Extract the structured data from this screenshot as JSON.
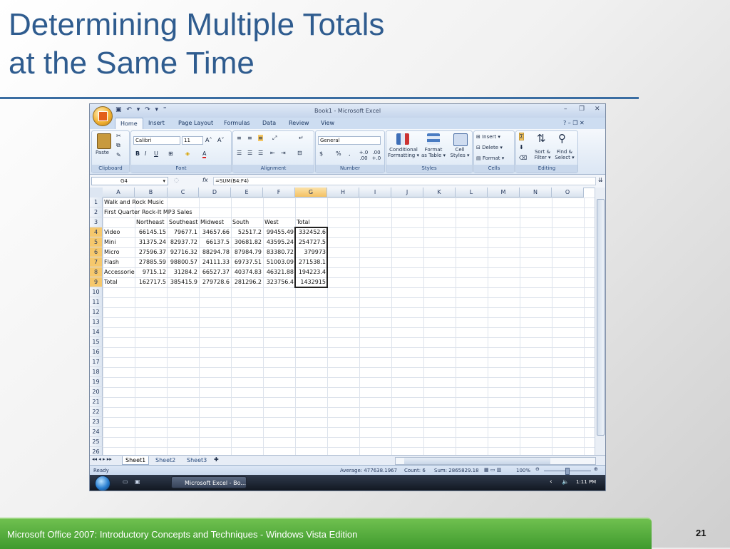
{
  "slide": {
    "title_line1": "Determining Multiple Totals",
    "title_line2": "at the Same Time",
    "footer": "Microsoft Office 2007: Introductory Concepts and Techniques - Windows Vista Edition",
    "page_number": "21"
  },
  "window": {
    "title": "Book1 - Microsoft Excel",
    "qat": "▣ ↶ ▾ ↷ ▾ ⁼",
    "minimize": "–",
    "restore": "❐",
    "close": "✕",
    "help": "? – ❐ ✕"
  },
  "ribbon_tabs": [
    "Home",
    "Insert",
    "Page Layout",
    "Formulas",
    "Data",
    "Review",
    "View"
  ],
  "ribbon": {
    "paste": "Paste",
    "font_name": "Calibri",
    "font_size": "11",
    "grow_font": "A˄",
    "shrink_font": "A˅",
    "bold": "B",
    "italic": "I",
    "underline": "U",
    "font_color": "A",
    "number_format": "General",
    "currency": "$",
    "percent": "%",
    "comma": ",",
    "inc_decimal": "+.0 .00",
    "dec_decimal": ".00 +.0",
    "conditional_1": "Conditional",
    "conditional_2": "Formatting ▾",
    "format_table_1": "Format",
    "format_table_2": "as Table ▾",
    "cell_styles_1": "Cell",
    "cell_styles_2": "Styles ▾",
    "insert": "Insert ▾",
    "delete": "Delete ▾",
    "format": "Format ▾",
    "sort_1": "Sort &",
    "sort_2": "Filter ▾",
    "find_1": "Find &",
    "find_2": "Select ▾",
    "groups": {
      "clipboard": "Clipboard",
      "font": "Font",
      "alignment": "Alignment",
      "number": "Number",
      "styles": "Styles",
      "cells": "Cells",
      "editing": "Editing"
    }
  },
  "formula_bar": {
    "name_box": "G4",
    "fx": "fx",
    "formula": "=SUM(B4:F4)"
  },
  "columns": [
    "A",
    "B",
    "C",
    "D",
    "E",
    "F",
    "G",
    "H",
    "I",
    "J",
    "K",
    "L",
    "M",
    "N",
    "O"
  ],
  "rows": [
    "1",
    "2",
    "3",
    "4",
    "5",
    "6",
    "7",
    "8",
    "9",
    "10",
    "11",
    "12",
    "13",
    "14",
    "15",
    "16",
    "17",
    "18",
    "19",
    "20",
    "21",
    "22",
    "23",
    "24",
    "25",
    "26"
  ],
  "sheet": {
    "title": "Walk and Rock Music",
    "subtitle": "First Quarter Rock-It MP3 Sales",
    "headers": [
      "Northeast",
      "Southeast",
      "Midwest",
      "South",
      "West",
      "Total"
    ],
    "data": [
      {
        "label": "Video",
        "values": [
          "66145.15",
          "79677.1",
          "34657.66",
          "52517.2",
          "99455.49",
          "332452.6"
        ]
      },
      {
        "label": "Mini",
        "values": [
          "31375.24",
          "82937.72",
          "66137.5",
          "30681.82",
          "43595.24",
          "254727.5"
        ]
      },
      {
        "label": "Micro",
        "values": [
          "27596.37",
          "92716.32",
          "88294.78",
          "87984.79",
          "83380.72",
          "379973"
        ]
      },
      {
        "label": "Flash",
        "values": [
          "27885.59",
          "98800.57",
          "24111.33",
          "69737.51",
          "51003.09",
          "271538.1"
        ]
      },
      {
        "label": "Accessorie",
        "values": [
          "9715.12",
          "31284.2",
          "66527.37",
          "40374.83",
          "46321.88",
          "194223.4"
        ]
      },
      {
        "label": "Total",
        "values": [
          "162717.5",
          "385415.9",
          "279728.6",
          "281296.2",
          "323756.4",
          "1432915"
        ]
      }
    ]
  },
  "sheet_tabs": [
    "Sheet1",
    "Sheet2",
    "Sheet3"
  ],
  "status": {
    "ready": "Ready",
    "average": "Average: 477638.1967",
    "count": "Count: 6",
    "sum": "Sum: 2865829.18",
    "zoom": "100%"
  },
  "taskbar": {
    "excel_button": "Microsoft Excel - Bo...",
    "time": "1:11 PM"
  }
}
